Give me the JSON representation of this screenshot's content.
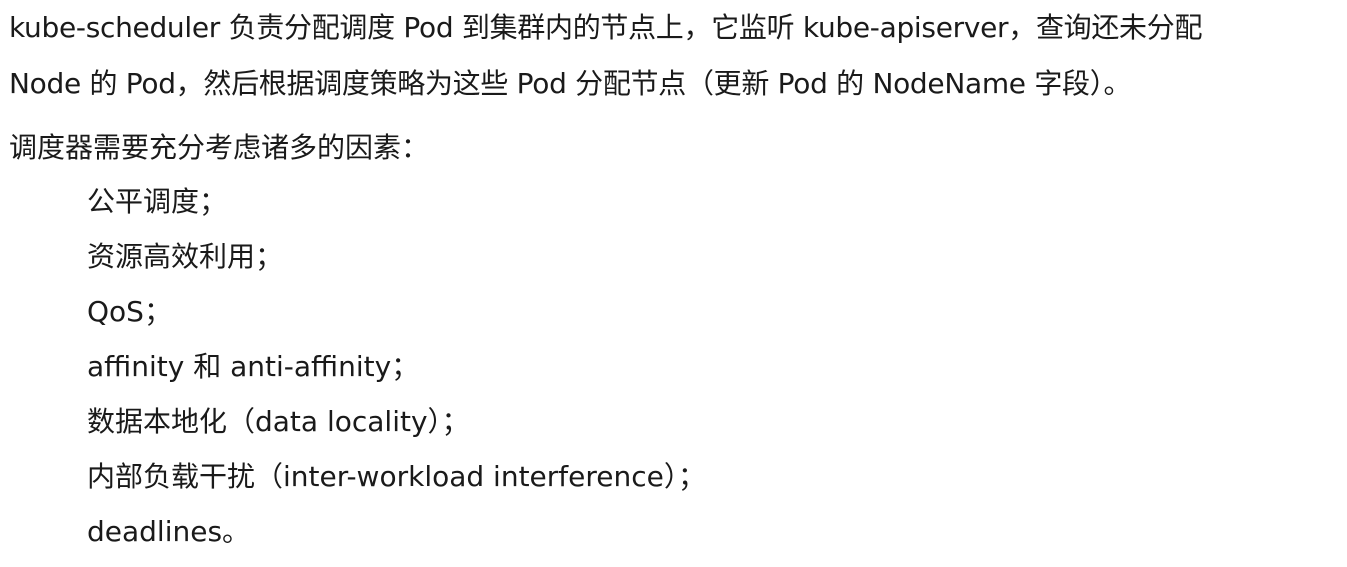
{
  "paragraph": {
    "line1": "kube-scheduler 负责分配调度 Pod 到集群内的节点上，它监听 kube-apiserver，查询还未分配",
    "line2": "Node 的 Pod，然后根据调度策略为这些 Pod 分配节点（更新 Pod 的 NodeName 字段）。"
  },
  "factors": {
    "heading": "调度器需要充分考虑诸多的因素：",
    "items": [
      "公平调度；",
      "资源高效利用；",
      "QoS；",
      "affinity 和 anti-affinity；",
      "数据本地化（data locality）；",
      "内部负载干扰（inter-workload interference）；",
      "deadlines。"
    ]
  }
}
